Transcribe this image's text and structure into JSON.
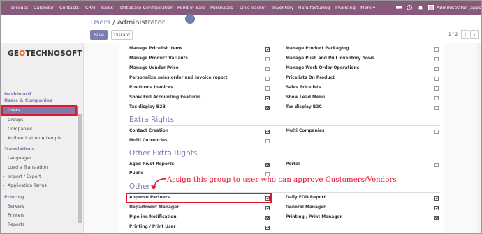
{
  "navbar": {
    "menu": [
      "Discuss",
      "Calendar",
      "Contacts",
      "CRM",
      "Sales",
      "Database Configuration",
      "Point of Sale",
      "Purchases",
      "Link Tracker",
      "Inventory",
      "Manufacturing",
      "Invoicing",
      "More ▾"
    ],
    "user": "Administrator (apps1",
    "icons": [
      "chat-icon",
      "clock-icon",
      "bell-icon"
    ]
  },
  "breadcrumb": {
    "parent": "Users",
    "separator": " / ",
    "current": "Administrator"
  },
  "buttons": {
    "save": "Save",
    "discard": "Discard"
  },
  "pager": {
    "text": "1 / 2",
    "prev": "‹",
    "next": "›"
  },
  "logo": {
    "prefix": "GE",
    "o": "O",
    "suffix": "TECHNOSOFT"
  },
  "sidebar": {
    "sections": [
      {
        "heading": "Dashboard"
      },
      {
        "heading": "Users & Companies",
        "items": [
          "Users",
          "Groups",
          "Companies",
          "Authentication Attempts"
        ]
      },
      {
        "heading": "Translations",
        "items": [
          "Languages",
          "Load a Translation",
          "Import / Export",
          "Application Terms"
        ]
      },
      {
        "heading": "Printing",
        "items": [
          "Servers",
          "Printers",
          "Reports"
        ]
      }
    ],
    "active": "Users",
    "expand_marker": "›"
  },
  "form": {
    "top_rows": [
      {
        "left": "Manage Pricelist Items",
        "left_checked": true,
        "right": "Manage Product Packaging",
        "right_checked": false
      },
      {
        "left": "Manage Product Variants",
        "left_checked": false,
        "right": "Manage Push and Pull inventory flows",
        "right_checked": false
      },
      {
        "left": "Manage Vendor Price",
        "left_checked": false,
        "right": "Manage Work Order Operations",
        "right_checked": false
      },
      {
        "left": "Personalize sales order and invoice report",
        "left_checked": false,
        "right": "Pricelists On Product",
        "right_checked": false
      },
      {
        "left": "Pro-forma Invoices",
        "left_checked": false,
        "right": "Sales Pricelists",
        "right_checked": false
      },
      {
        "left": "Show Full Accounting Features",
        "left_checked": true,
        "right": "Show Lead Menu",
        "right_checked": false
      },
      {
        "left": "Tax display B2B",
        "left_checked": true,
        "right": "Tax display B2C",
        "right_checked": false
      }
    ],
    "sections": [
      {
        "title": "Extra Rights",
        "rows": [
          {
            "left": "Contact Creation",
            "left_checked": true,
            "right": "Multi Companies",
            "right_checked": false
          },
          {
            "left": "Multi Currencies",
            "left_checked": false
          }
        ]
      },
      {
        "title": "Other Extra Rights",
        "rows": [
          {
            "left": "Aged Pivot Reports",
            "left_checked": true,
            "right": "Portal",
            "right_checked": false
          },
          {
            "left": "Public",
            "left_checked": false
          }
        ]
      },
      {
        "title": "Other",
        "rows": [
          {
            "left": "Approve Partners",
            "left_checked": true,
            "right": "Daily EOD Report",
            "right_checked": true
          },
          {
            "left": "Department Manager",
            "left_checked": true,
            "right": "General Manager",
            "right_checked": true
          },
          {
            "left": "Pipeline Notification",
            "left_checked": true,
            "right": "Printing / Print Manager",
            "right_checked": true
          },
          {
            "left": "Printing / Print User",
            "left_checked": true
          }
        ]
      }
    ]
  },
  "annotation": "Assign this group to user who can approve Customers/Vendors",
  "colors": {
    "navbar": "#875a7b",
    "accent": "#7c7bad",
    "highlight": "#e8142d",
    "logo_accent": "#e5611e"
  }
}
